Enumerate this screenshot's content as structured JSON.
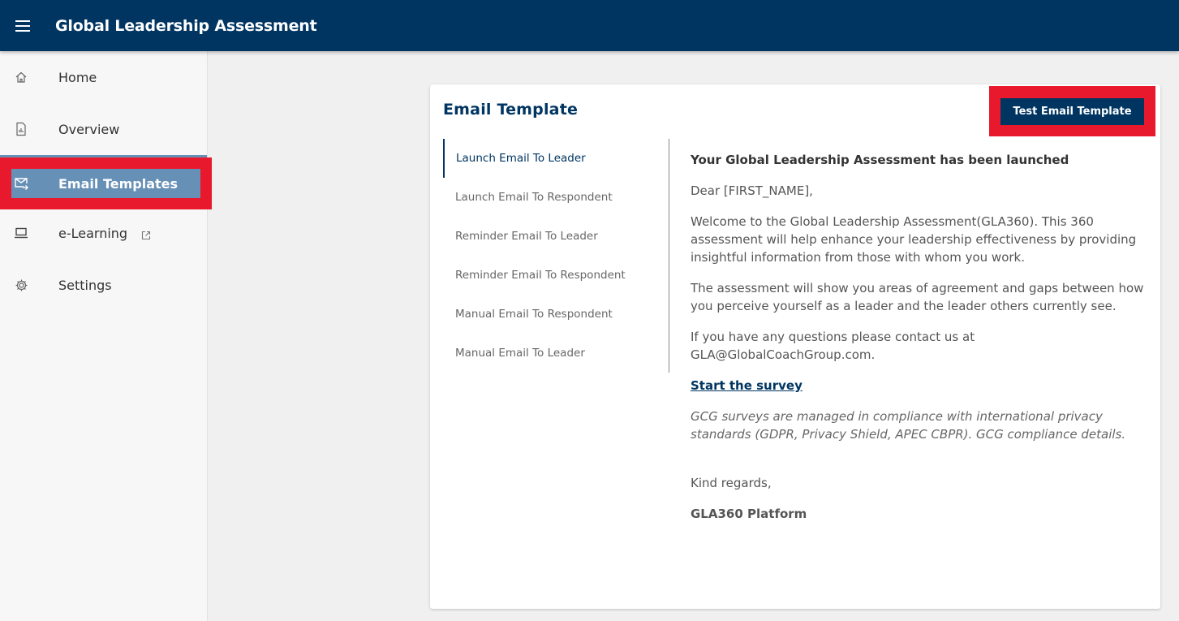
{
  "app": {
    "title": "Global Leadership Assessment"
  },
  "sidebar": {
    "items": [
      {
        "label": "Home",
        "icon": "home-icon"
      },
      {
        "label": "Overview",
        "icon": "report-icon"
      },
      {
        "label": "Email Templates",
        "icon": "email-forward-icon",
        "active": true
      },
      {
        "label": "e-Learning",
        "icon": "laptop-icon",
        "external": true
      },
      {
        "label": "Settings",
        "icon": "gear-icon"
      }
    ]
  },
  "card": {
    "title": "Email Template",
    "test_button": "Test Email Template",
    "tabs": [
      "Launch Email To Leader",
      "Launch Email To Respondent",
      "Reminder Email To Leader",
      "Reminder Email To Respondent",
      "Manual Email To Respondent",
      "Manual Email To Leader"
    ],
    "active_tab": 0,
    "email": {
      "heading": "Your Global Leadership Assessment has been launched",
      "greeting": "Dear [FIRST_NAME],",
      "para1": "Welcome to the Global Leadership Assessment(GLA360). This 360 assessment will help enhance your leadership effectiveness by providing insightful information from those with whom you work.",
      "para2": "The assessment will show you areas of agreement and gaps between how you perceive yourself as a leader and the leader others currently see.",
      "para3": "If you have any questions please contact us at GLA@GlobalCoachGroup.com.",
      "link": "Start the survey",
      "compliance": "GCG surveys are managed in compliance with international privacy standards (GDPR, Privacy Shield, APEC CBPR). GCG compliance details.",
      "closing": "Kind regards,",
      "signature": "GLA360 Platform"
    }
  },
  "colors": {
    "primary": "#003562",
    "active_nav": "#6790b6",
    "highlight": "#e8192c"
  }
}
